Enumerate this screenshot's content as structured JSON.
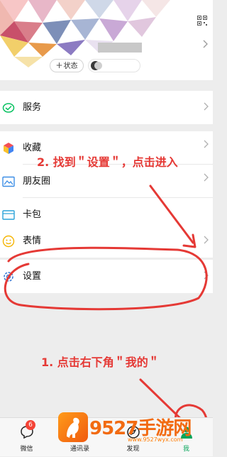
{
  "profile": {
    "status_label": "状态"
  },
  "menu": {
    "service": "服务",
    "favorites": "收藏",
    "moments": "朋友圈",
    "cards": "卡包",
    "stickers": "表情",
    "settings": "设置"
  },
  "annotations": {
    "step2": "2. 找到＂设置＂，点击进入",
    "step1": "1. 点击右下角＂我的＂"
  },
  "tabbar": {
    "chats": "微信",
    "chats_badge": "6",
    "contacts": "通讯录",
    "discover": "发现",
    "me": "我"
  },
  "watermark": {
    "brand": "9527手游网",
    "url": "www.9527wyx.com"
  },
  "colors": {
    "accent_red": "#e53935",
    "wechat_green": "#07c160",
    "watermark_orange": "#f26b12"
  }
}
